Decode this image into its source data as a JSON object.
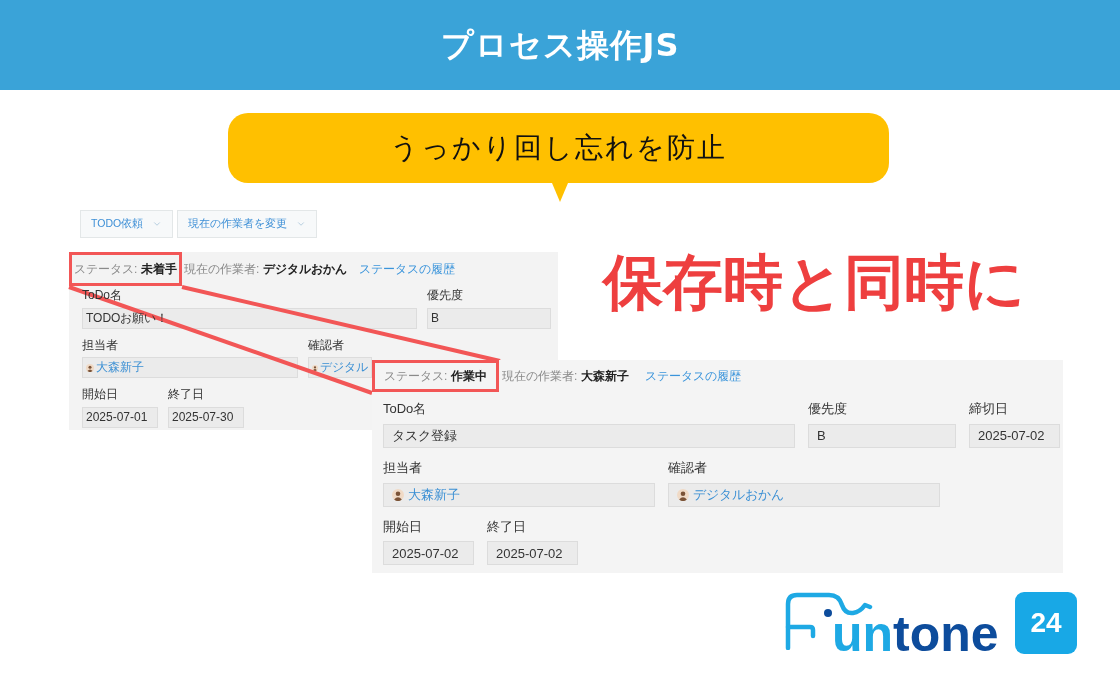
{
  "header": {
    "title": "プロセス操作JS"
  },
  "callout": {
    "text": "うっかり回し忘れを防止"
  },
  "headline": {
    "text": "保存時と同時に"
  },
  "before_screen": {
    "action_buttons": [
      {
        "label": "TODO依頼"
      },
      {
        "label": "現在の作業者を変更"
      }
    ],
    "status": {
      "label": "ステータス:",
      "value": "未着手",
      "highlighted": true
    },
    "current_worker": {
      "label": "現在の作業者:",
      "value": "デジタルおかん"
    },
    "history_link": "ステータスの履歴",
    "rows": [
      [
        {
          "kind": "title",
          "label": "ToDo名",
          "value": "TODOお願い！"
        },
        {
          "kind": "choice",
          "label": "優先度",
          "value": "B"
        }
      ],
      [
        {
          "kind": "user",
          "label": "担当者",
          "value": "大森新子"
        },
        {
          "kind": "user",
          "label": "確認者",
          "value": "デジタル"
        }
      ],
      [
        {
          "kind": "date",
          "label": "開始日",
          "value": "2025-07-01"
        },
        {
          "kind": "date",
          "label": "終了日",
          "value": "2025-07-30"
        }
      ]
    ]
  },
  "after_screen": {
    "status": {
      "label": "ステータス:",
      "value": "作業中",
      "highlighted": true
    },
    "current_worker": {
      "label": "現在の作業者:",
      "value": "大森新子"
    },
    "history_link": "ステータスの履歴",
    "rows": [
      [
        {
          "kind": "title",
          "label": "ToDo名",
          "value": "タスク登録"
        },
        {
          "kind": "choice",
          "label": "優先度",
          "value": "B"
        },
        {
          "kind": "date",
          "label": "締切日",
          "value": "2025-07-02"
        }
      ],
      [
        {
          "kind": "user",
          "label": "担当者",
          "value": "大森新子"
        },
        {
          "kind": "user",
          "label": "確認者",
          "value": "デジタルおかん"
        }
      ],
      [
        {
          "kind": "date",
          "label": "開始日",
          "value": "2025-07-02"
        },
        {
          "kind": "date",
          "label": "終了日",
          "value": "2025-07-02"
        }
      ]
    ]
  },
  "logo": {
    "wordmark_parts": [
      {
        "text": "un",
        "color": "#1ea9e4"
      },
      {
        "text": "tone",
        "color": "#0d4c9c"
      }
    ],
    "badge": "24"
  }
}
